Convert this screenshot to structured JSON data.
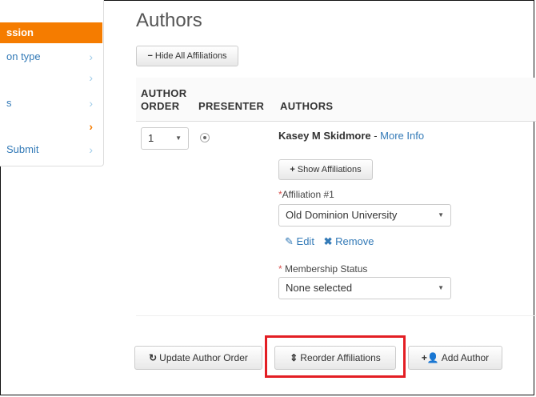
{
  "sidebar": {
    "active": "ssion",
    "items": [
      {
        "label": "on type",
        "chevron": "›"
      },
      {
        "label": "",
        "chevron": "›"
      },
      {
        "label": "s",
        "chevron": "›"
      },
      {
        "label": "",
        "chevron": "›"
      },
      {
        "label": "Submit",
        "chevron": "›"
      }
    ]
  },
  "main": {
    "title": "Authors",
    "hide_affiliations": "Hide All Affiliations",
    "columns": {
      "order_line1": "AUTHOR",
      "order_line2": "ORDER",
      "presenter": "PRESENTER",
      "authors": "AUTHORS"
    },
    "author": {
      "order": "1",
      "name": "Kasey M Skidmore",
      "separator": " - ",
      "more_info": "More Info",
      "show_affiliations": "Show Affiliations",
      "affiliation_label": "Affiliation #1",
      "affiliation_value": "Old Dominion University",
      "edit": "Edit",
      "remove": "Remove",
      "membership_label": " Membership Status",
      "membership_value": "None selected"
    },
    "actions": {
      "update_order": "Update Author Order",
      "reorder": "Reorder Affiliations",
      "add_author": "Add Author"
    }
  },
  "colors": {
    "accent": "#f57c00",
    "link": "#337ab7",
    "highlight": "#e31e24",
    "required": "#d9534f"
  }
}
